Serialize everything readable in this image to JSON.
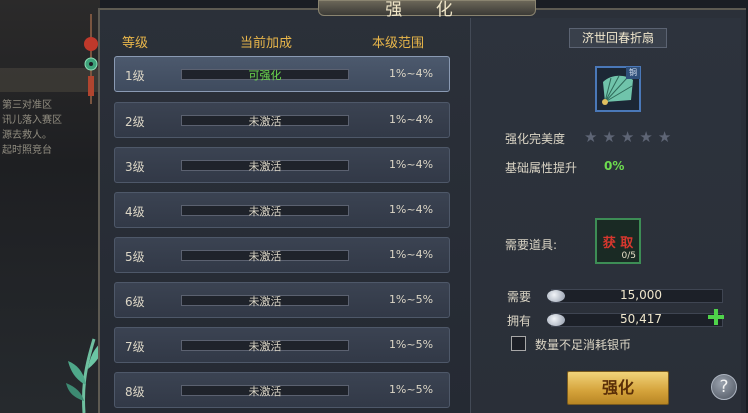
{
  "window": {
    "title": "强 化"
  },
  "background": {
    "quest_lines": [
      "第三对准区",
      "讯儿落入赛区",
      "源去救人。",
      "起时照竞台"
    ]
  },
  "table": {
    "headers": {
      "level": "等级",
      "bonus": "当前加成",
      "range": "本级范围"
    },
    "rows": [
      {
        "level": "1级",
        "status": "可强化",
        "range": "1%~4%",
        "active": true
      },
      {
        "level": "2级",
        "status": "未激活",
        "range": "1%~4%"
      },
      {
        "level": "3级",
        "status": "未激活",
        "range": "1%~4%"
      },
      {
        "level": "4级",
        "status": "未激活",
        "range": "1%~4%"
      },
      {
        "level": "5级",
        "status": "未激活",
        "range": "1%~4%"
      },
      {
        "level": "6级",
        "status": "未激活",
        "range": "1%~5%"
      },
      {
        "level": "7级",
        "status": "未激活",
        "range": "1%~5%"
      },
      {
        "level": "8级",
        "status": "未激活",
        "range": "1%~5%"
      }
    ]
  },
  "item": {
    "name": "济世回春折扇",
    "tag": "铜",
    "perfection_label": "强化完美度",
    "stars_total": 5,
    "stars_filled": 0,
    "attr_label": "基础属性提升",
    "attr_value": "0%"
  },
  "requirement": {
    "label": "需要道具:",
    "acquire": "获 取",
    "count": "0/5",
    "need_label": "需要",
    "need_value": "15,000",
    "own_label": "拥有",
    "own_value": "50,417"
  },
  "option": {
    "label": "数量不足消耗银币"
  },
  "actions": {
    "strengthen": "强化",
    "help": "?"
  },
  "colors": {
    "accent_gold": "#e8b64a",
    "active_green": "#6ddc4f",
    "acquire_red": "#d7372e"
  }
}
